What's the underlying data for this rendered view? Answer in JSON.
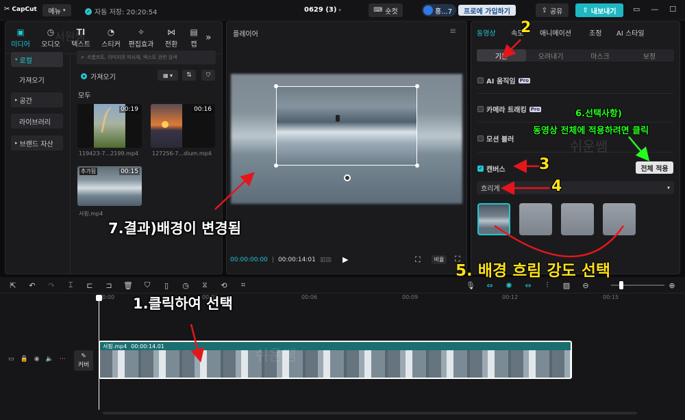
{
  "app": {
    "logo": "CapCut",
    "menu": "메뉴",
    "autosave": "자동 저장: 20:20:54",
    "project": "0629 (3)",
    "shortcut": "숏컷",
    "user": "홍...7",
    "pro_join": "프로에 가입하기",
    "share": "공유",
    "export": "내보내기"
  },
  "tabs": [
    {
      "label": "미디어"
    },
    {
      "label": "오디오"
    },
    {
      "label": "텍스트"
    },
    {
      "label": "스티커"
    },
    {
      "label": "편집효과"
    },
    {
      "label": "전환"
    },
    {
      "label": "캡"
    }
  ],
  "sidebar": {
    "local": "로컬",
    "import": "가져오기",
    "space": "공간",
    "library": "라이브러리",
    "brand": "브랜드 자산"
  },
  "media": {
    "search_placeholder": "프롬프트, 이미지의 피사체, 텍스트 관련 검색",
    "import_label": "가져오기",
    "all_label": "모두",
    "items": [
      {
        "name": "119423-7...2199.mp4",
        "duration": "00:19"
      },
      {
        "name": "127256-7...dium.mp4",
        "duration": "00:16"
      },
      {
        "name": "서핑.mp4",
        "duration": "00:15",
        "badge": "추가됨"
      }
    ]
  },
  "player": {
    "title": "플레이어",
    "time_current": "00:00:00:00",
    "time_total": "00:00:14:01",
    "ratio": "비율"
  },
  "right_panel": {
    "tabs": [
      "동영상",
      "속도",
      "애니메이션",
      "조정",
      "AI 스타일"
    ],
    "subtabs": [
      "기본",
      "오려내기",
      "마스크",
      "보정"
    ],
    "ai_motion": "AI 움직임",
    "camera_track": "카메라 트래킹",
    "motion_blur": "모션 블러",
    "canvas": "캔버스",
    "apply_all": "전체 적용",
    "blur_select": "흐리게",
    "pro_badge": "Pro"
  },
  "timeline": {
    "ticks": [
      "00:00",
      "00:03",
      "00:06",
      "00:09",
      "00:12",
      "00:15"
    ],
    "cover_label": "커버",
    "clip_label": "서핑.mp4",
    "clip_duration": "00:00:14.01"
  },
  "annotations": {
    "a1": "1.클릭하여 선택",
    "a2": "2",
    "a3": "3",
    "a4": "4",
    "a5": "5. 배경 흐림 강도 선택",
    "a6_line1": "6.선택사항)",
    "a6_line2": "동영상 전체에 적용하려면 클릭",
    "a7": "7.결과)배경이 변경됨"
  },
  "watermarks": [
    "서원쌤",
    "쉬운쌤",
    "쉬운쌤"
  ],
  "colors": {
    "accent": "#20c4cb",
    "annotation_red": "#e5161b",
    "annotation_yellow": "#ffe31a",
    "annotation_green": "#27ff1f"
  }
}
